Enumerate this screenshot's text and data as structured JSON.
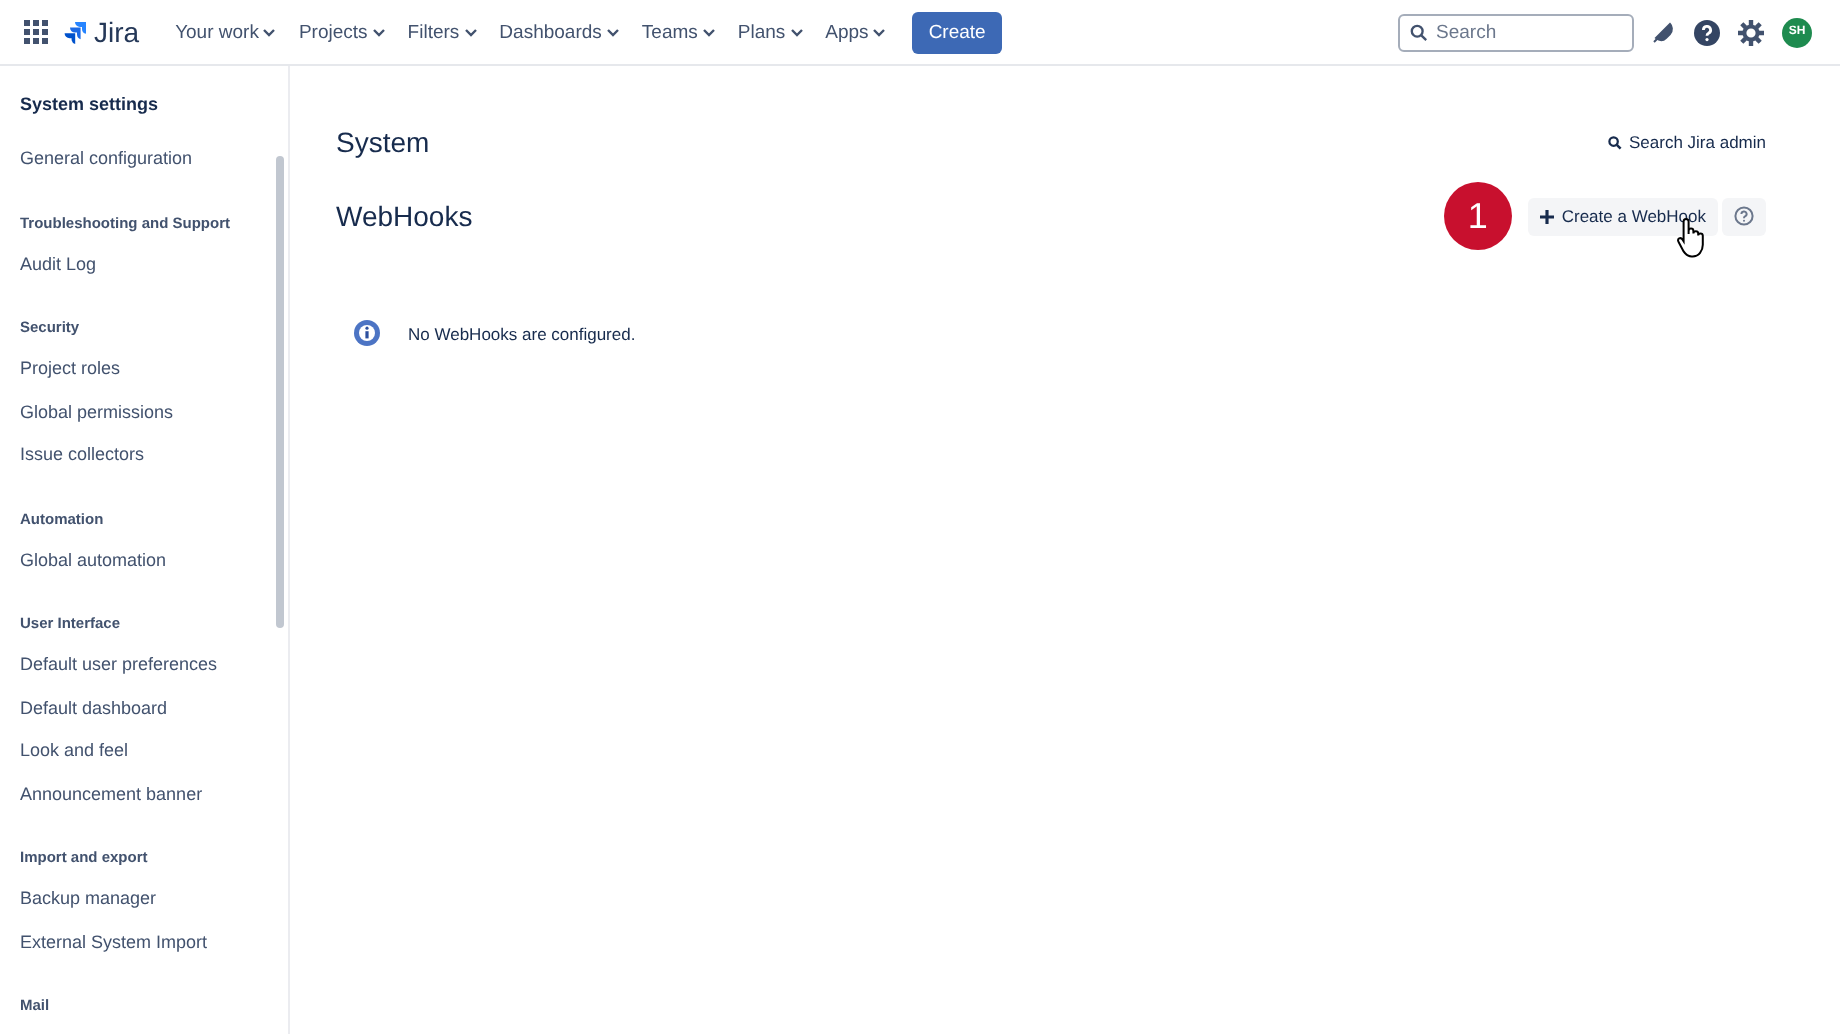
{
  "topbar": {
    "logo": "Jira",
    "nav": [
      {
        "label": "Your work"
      },
      {
        "label": "Projects"
      },
      {
        "label": "Filters"
      },
      {
        "label": "Dashboards"
      },
      {
        "label": "Teams"
      },
      {
        "label": "Plans"
      },
      {
        "label": "Apps"
      }
    ],
    "create": "Create",
    "search": {
      "placeholder": "Search"
    },
    "avatar": "SH"
  },
  "sidebar": {
    "title": "System settings",
    "sections": [
      {
        "items": [
          "General configuration"
        ]
      },
      {
        "heading": "Troubleshooting and Support",
        "items": [
          "Audit Log"
        ]
      },
      {
        "heading": "Security",
        "items": [
          "Project roles",
          "Global permissions",
          "Issue collectors"
        ]
      },
      {
        "heading": "Automation",
        "items": [
          "Global automation"
        ]
      },
      {
        "heading": "User Interface",
        "items": [
          "Default user preferences",
          "Default dashboard",
          "Look and feel",
          "Announcement banner"
        ]
      },
      {
        "heading": "Import and export",
        "items": [
          "Backup manager",
          "External System Import"
        ]
      },
      {
        "heading": "Mail"
      }
    ]
  },
  "main": {
    "title": "System",
    "search_admin": "Search Jira admin",
    "heading": "WebHooks",
    "step": "1",
    "create_button": "Create a WebHook",
    "message": "No WebHooks are configured."
  }
}
